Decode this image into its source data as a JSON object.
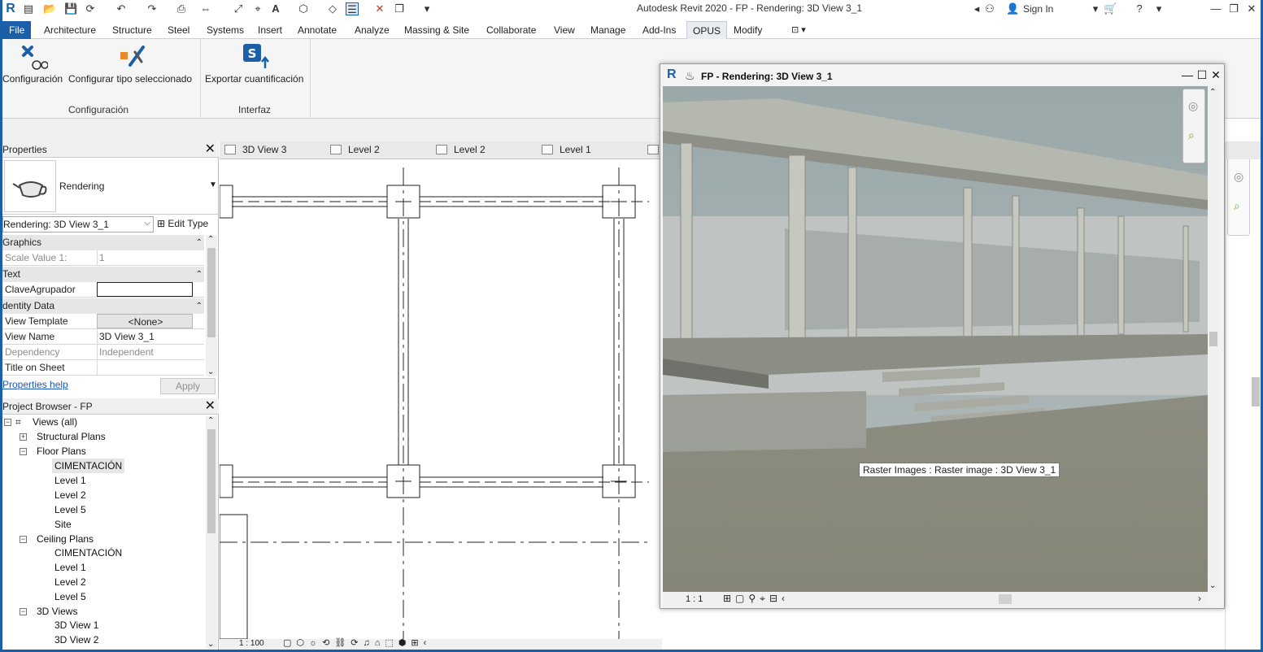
{
  "app": {
    "title": "Autodesk Revit 2020 - FP - Rendering: 3D View 3_1",
    "sign_in": "Sign In"
  },
  "ribbon": {
    "tabs": [
      "File",
      "Architecture",
      "Structure",
      "Steel",
      "Systems",
      "Insert",
      "Annotate",
      "Analyze",
      "Massing & Site",
      "Collaborate",
      "View",
      "Manage",
      "Add-Ins",
      "OPUS",
      "Modify"
    ],
    "active_tab": "OPUS",
    "buttons": {
      "configuracion": "Configuración",
      "configurar_tipo": "Configurar tipo seleccionado",
      "exportar": "Exportar cuantificación"
    },
    "groups": {
      "configuracion": "Configuración",
      "interfaz": "Interfaz"
    }
  },
  "properties": {
    "title": "Properties",
    "type_name": "Rendering",
    "instance_selector": "Rendering: 3D View 3_1",
    "edit_type": "Edit Type",
    "sections": {
      "graphics": "Graphics",
      "text": "Text",
      "identity": "dentity Data"
    },
    "rows": {
      "scale_key": "Scale Value    1:",
      "scale_val": "1",
      "clave_key": "ClaveAgrupador",
      "clave_val": "",
      "template_key": "View Template",
      "template_val": "<None>",
      "viewname_key": "View Name",
      "viewname_val": "3D View 3_1",
      "dependency_key": "Dependency",
      "dependency_val": "Independent",
      "titlesheet_key": "Title on Sheet",
      "titlesheet_val": ""
    },
    "help": "Properties help",
    "apply": "Apply"
  },
  "browser": {
    "title": "Project Browser - FP",
    "items": {
      "views_all": "Views (all)",
      "structural": "Structural Plans",
      "floor": "Floor Plans",
      "fp_cimentacion": "CIMENTACIÓN",
      "fp_level1": "Level 1",
      "fp_level2": "Level 2",
      "fp_level5": "Level 5",
      "fp_site": "Site",
      "ceiling": "Ceiling Plans",
      "cp_cimentacion": "CIMENTACIÓN",
      "cp_level1": "Level 1",
      "cp_level2": "Level 2",
      "cp_level5": "Level 5",
      "views3d": "3D Views",
      "v3d1": "3D View 1",
      "v3d2": "3D View 2"
    }
  },
  "view_tabs": [
    "3D View 3",
    "Level 2",
    "Level 2",
    "Level 1"
  ],
  "canvas": {
    "scale": "1 : 100"
  },
  "render_window": {
    "title": "FP - Rendering: 3D View 3_1",
    "scale": "1 : 1",
    "tooltip": "Raster Images : Raster image : 3D View 3_1"
  }
}
